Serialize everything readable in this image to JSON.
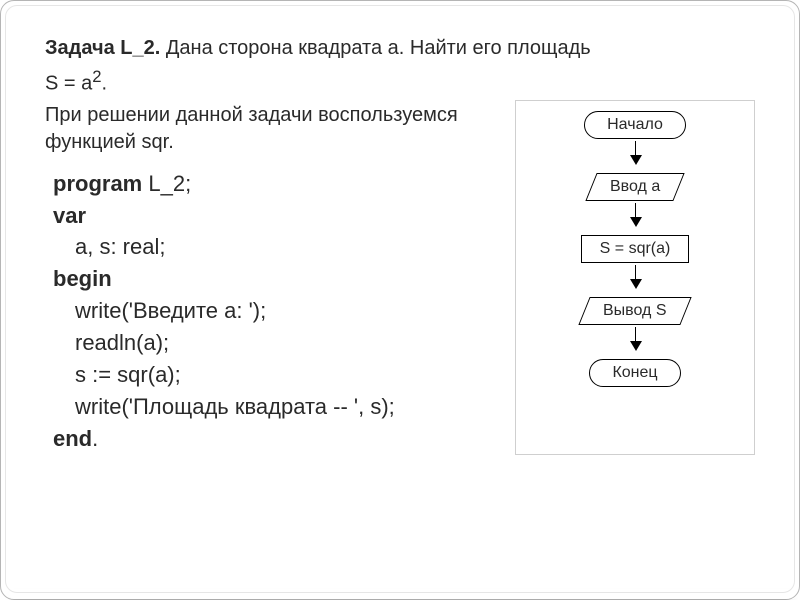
{
  "heading": {
    "label": "Задача L_2.",
    "statement_part1": " Дана сторона квадрата a. Найти его площадь",
    "formula": "S = a",
    "formula_sup": "2",
    "formula_tail": "."
  },
  "sub": {
    "line1": "При решении данной задачи воспользуемся",
    "line2_prefix": "функцией ",
    "line2_bold": "sqr",
    "line2_tail": "."
  },
  "code": {
    "l1_kw": "program",
    "l1_rest": " L_2;",
    "l2_kw": "var",
    "l3": "a, s: real;",
    "l4_kw": "begin",
    "l5": "write('Введите a: ');",
    "l6": "readln(a);",
    "l7": "s := sqr(a);",
    "l8": "write('Площадь квадрата -- ', s);",
    "l9_kw": "end",
    "l9_tail": "."
  },
  "flow": {
    "start": "Начало",
    "input": "Ввод a",
    "process": "S = sqr(a)",
    "output": "Вывод S",
    "end": "Конец"
  },
  "chart_data": {
    "type": "table",
    "description": "Flowchart sequence for computing square area",
    "nodes": [
      {
        "id": "start",
        "shape": "terminator",
        "label": "Начало"
      },
      {
        "id": "input",
        "shape": "parallelogram",
        "label": "Ввод a"
      },
      {
        "id": "process",
        "shape": "rectangle",
        "label": "S = sqr(a)"
      },
      {
        "id": "output",
        "shape": "parallelogram",
        "label": "Вывод S"
      },
      {
        "id": "end",
        "shape": "terminator",
        "label": "Конец"
      }
    ],
    "edges": [
      [
        "start",
        "input"
      ],
      [
        "input",
        "process"
      ],
      [
        "process",
        "output"
      ],
      [
        "output",
        "end"
      ]
    ]
  }
}
